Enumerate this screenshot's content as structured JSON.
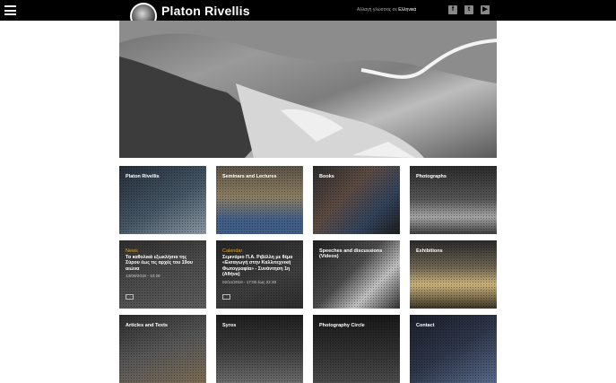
{
  "header": {
    "menu_icon": "hamburger-icon",
    "site_title": "Platon Rivellis",
    "language_prefix": "Αλλαγή γλώσσας σε",
    "language_link": "Ελληνικά",
    "social_icons": [
      "facebook-icon",
      "twitter-icon",
      "youtube-icon"
    ]
  },
  "tiles": [
    {
      "title": "Platon Rivellis"
    },
    {
      "title": "Seminars and Lectures"
    },
    {
      "title": "Books"
    },
    {
      "title": "Photographs"
    },
    {
      "category": "News",
      "text": "Τα καθολικά εξωκλήσια της Σύρου έως τις αρχές του 19ου αιώνα",
      "date": "13/09/2018 - 10:28"
    },
    {
      "category": "Calendar",
      "text": "Σεμινάριο Π.Α. Ριβέλλη με θέμα «Εισαγωγή στην Καλλιτεχνική Φωτογραφία» - Συνάντηση 1η (Αθήνα)",
      "date": "02/11/2018 - 17:00 έως 22:30"
    },
    {
      "title": "Speeches and discussions (Videos)"
    },
    {
      "title": "Exhibitions"
    },
    {
      "title": "Articles and Texts"
    },
    {
      "title": "Syros"
    },
    {
      "title": "Photography Circle"
    },
    {
      "title": "Contact"
    }
  ]
}
